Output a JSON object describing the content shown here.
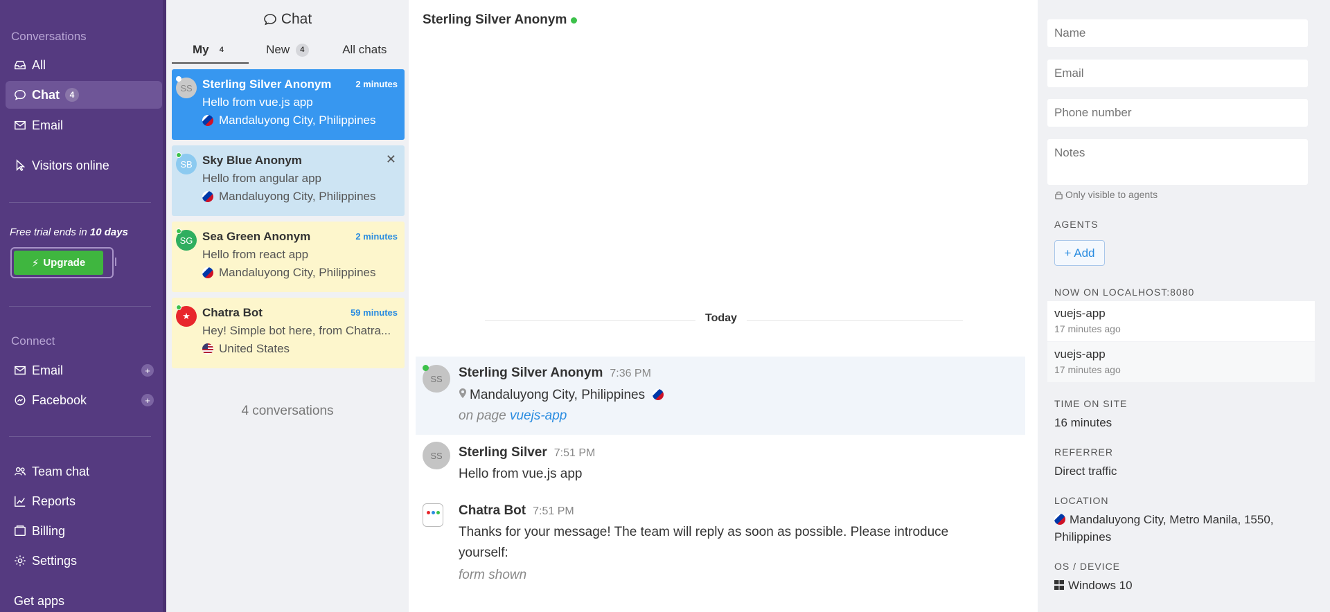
{
  "sidebar": {
    "conversations_label": "Conversations",
    "items": [
      {
        "label": "All"
      },
      {
        "label": "Chat",
        "badge": "4"
      },
      {
        "label": "Email"
      },
      {
        "label": "Visitors online"
      }
    ],
    "trial_prefix": "Free trial ends in",
    "trial_days": "10 days",
    "upgrade_label": "Upgrade",
    "connect_label": "Connect",
    "connect_items": [
      {
        "label": "Email",
        "plus": "+"
      },
      {
        "label": "Facebook",
        "plus": "+"
      }
    ],
    "bottom_items": [
      {
        "label": "Team chat"
      },
      {
        "label": "Reports"
      },
      {
        "label": "Billing"
      },
      {
        "label": "Settings"
      }
    ],
    "get_apps": "Get apps"
  },
  "chatlist": {
    "title": "Chat",
    "tabs": [
      {
        "label": "My",
        "badge": "4"
      },
      {
        "label": "New",
        "badge": "4"
      },
      {
        "label": "All chats"
      }
    ],
    "conversations": [
      {
        "initials": "SS",
        "name": "Sterling Silver Anonym",
        "time": "2 minutes",
        "message": "Hello from vue.js app",
        "location": "Mandaluyong City, Philippines"
      },
      {
        "initials": "SB",
        "name": "Sky Blue Anonym",
        "close": "✕",
        "message": "Hello from angular app",
        "location": "Mandaluyong City, Philippines"
      },
      {
        "initials": "SG",
        "name": "Sea Green Anonym",
        "time": "2 minutes",
        "message": "Hello from react app",
        "location": "Mandaluyong City, Philippines"
      },
      {
        "initials": "★",
        "name": "Chatra Bot",
        "time": "59 minutes",
        "message": "Hey! Simple bot here, from Chatra...",
        "location": "United States"
      }
    ],
    "count": "4 conversations"
  },
  "main": {
    "header_name": "Sterling Silver Anonym",
    "day_separator": "Today",
    "event": {
      "initials": "SS",
      "name": "Sterling Silver Anonym",
      "time": "7:36 PM",
      "location": "Mandaluyong City, Philippines",
      "on_page_prefix": "on page",
      "page_link": "vuejs-app"
    },
    "messages": [
      {
        "initials": "SS",
        "name": "Sterling Silver",
        "time": "7:51 PM",
        "text": "Hello from vue.js app"
      },
      {
        "name": "Chatra Bot",
        "time": "7:51 PM",
        "text": "Thanks for your message! The team will reply as soon as possible. Please introduce yourself:",
        "note": "form shown"
      }
    ]
  },
  "info": {
    "name_placeholder": "Name",
    "email_placeholder": "Email",
    "phone_placeholder": "Phone number",
    "notes_placeholder": "Notes",
    "notes_hint": "Only visible to agents",
    "agents_label": "AGENTS",
    "add_label": "+ Add",
    "now_on_label": "NOW ON LOCALHOST:8080",
    "pages": [
      {
        "name": "vuejs-app",
        "ago": "17 minutes ago"
      },
      {
        "name": "vuejs-app",
        "ago": "17 minutes ago"
      }
    ],
    "time_on_site_label": "TIME ON SITE",
    "time_on_site": "16 minutes",
    "referrer_label": "REFERRER",
    "referrer": "Direct traffic",
    "location_label": "LOCATION",
    "location_line1": "Mandaluyong City, Metro Manila, 1550,",
    "location_line2": "Philippines",
    "os_label": "OS / DEVICE",
    "os": "Windows 10"
  }
}
